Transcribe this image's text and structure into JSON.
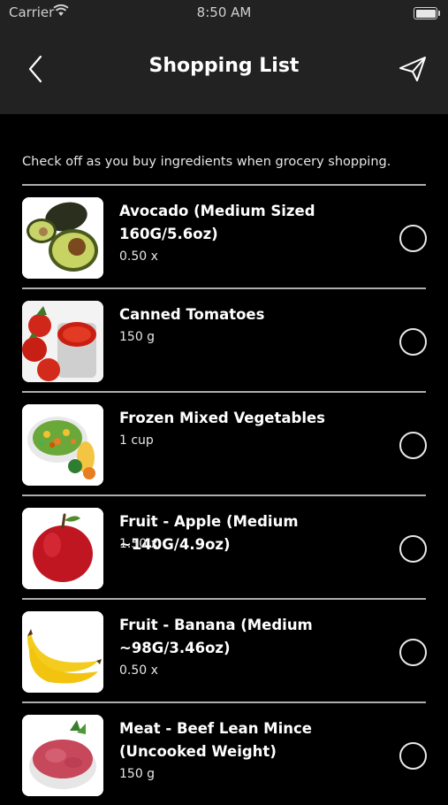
{
  "status_bar": {
    "carrier": "Carrier",
    "time": "8:50 AM",
    "icons": [
      "wifi-icon",
      "battery-icon"
    ]
  },
  "header": {
    "title": "Shopping List",
    "back_icon": "chevron-left-icon",
    "share_icon": "send-icon"
  },
  "intro": "Check off as you buy ingredients when grocery shopping.",
  "items": [
    {
      "name": "Avocado (Medium Sized 160G/5.6oz)",
      "qty": "0.50 x",
      "image": "avocado",
      "checked": false
    },
    {
      "name": "Canned Tomatoes",
      "qty": "150 g",
      "image": "canned-tomatoes",
      "checked": false
    },
    {
      "name": "Frozen Mixed Vegetables",
      "qty": "1 cup",
      "image": "mixed-vegetables",
      "checked": false
    },
    {
      "name": "Fruit - Apple (Medium ~140G/4.9oz)",
      "qty": "1.50 x",
      "image": "apple",
      "checked": false
    },
    {
      "name": "Fruit - Banana (Medium ~98G/3.46oz)",
      "qty": "0.50 x",
      "image": "banana",
      "checked": false
    },
    {
      "name": "Meat - Beef Lean Mince (Uncooked Weight)",
      "qty": "150 g",
      "image": "beef-mince",
      "checked": false
    }
  ],
  "colors": {
    "header_bg": "#222222",
    "background": "#000000",
    "text": "#ffffff"
  }
}
